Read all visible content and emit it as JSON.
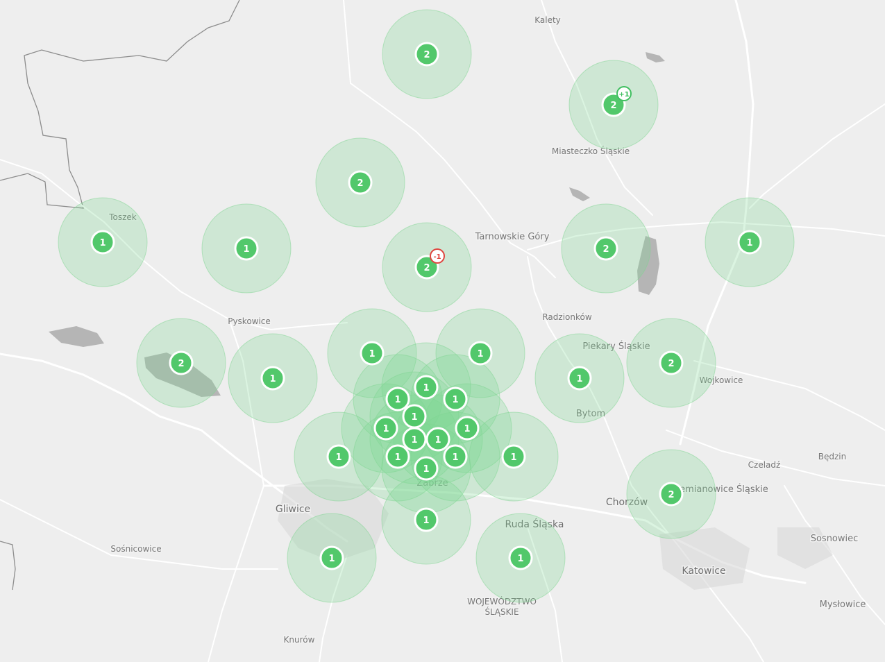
{
  "map": {
    "places": [
      {
        "name": "Kalety",
        "size": "small",
        "id": "kalety"
      },
      {
        "name": "Miasteczko Śląskie",
        "size": "small",
        "id": "miasteczko"
      },
      {
        "name": "Toszek",
        "size": "small",
        "id": "toszek"
      },
      {
        "name": "Tarnowskie Góry",
        "size": "med",
        "id": "tarnowskie-gory"
      },
      {
        "name": "Radzionków",
        "size": "small",
        "id": "radzionkow"
      },
      {
        "name": "Pyskowice",
        "size": "small",
        "id": "pyskowice"
      },
      {
        "name": "Piekary Śląskie",
        "size": "med",
        "id": "piekary"
      },
      {
        "name": "Wojkowice",
        "size": "small",
        "id": "wojkowice"
      },
      {
        "name": "Bytom",
        "size": "med",
        "id": "bytom"
      },
      {
        "name": "Czeladź",
        "size": "small",
        "id": "czeladz"
      },
      {
        "name": "Będzin",
        "size": "small",
        "id": "bedzin"
      },
      {
        "name": "Siemianowice Śląskie",
        "size": "med",
        "id": "siemianowice"
      },
      {
        "name": "Zabrze",
        "size": "med",
        "id": "zabrze"
      },
      {
        "name": "Gliwice",
        "size": "large",
        "id": "gliwice"
      },
      {
        "name": "Chorzów",
        "size": "large",
        "id": "chorzow"
      },
      {
        "name": "Ruda Śląska",
        "size": "large",
        "id": "ruda"
      },
      {
        "name": "Sośnicowice",
        "size": "small",
        "id": "sosnicowice"
      },
      {
        "name": "Sosnowiec",
        "size": "med",
        "id": "sosnowiec"
      },
      {
        "name": "Katowice",
        "size": "large",
        "id": "katowice"
      },
      {
        "name": "Mysłowice",
        "size": "med",
        "id": "myslowice"
      },
      {
        "name": "Knurów",
        "size": "small",
        "id": "knurow"
      },
      {
        "name": "WOJEWÓDZTWO",
        "size": "small",
        "id": "wojewodztwo-1"
      },
      {
        "name": "ŚLĄSKIE",
        "size": "small",
        "id": "wojewodztwo-2"
      }
    ],
    "clusters": [
      {
        "count": "2",
        "id": "c01"
      },
      {
        "count": "2",
        "id": "c02",
        "badge": "+1",
        "badge_color": "#3fbf5f"
      },
      {
        "count": "2",
        "id": "c03"
      },
      {
        "count": "1",
        "id": "c04"
      },
      {
        "count": "1",
        "id": "c05"
      },
      {
        "count": "2",
        "id": "c06",
        "badge": "-1",
        "badge_color": "#e0443e"
      },
      {
        "count": "2",
        "id": "c07"
      },
      {
        "count": "1",
        "id": "c08"
      },
      {
        "count": "2",
        "id": "c09"
      },
      {
        "count": "1",
        "id": "c10"
      },
      {
        "count": "1",
        "id": "c11"
      },
      {
        "count": "1",
        "id": "c12"
      },
      {
        "count": "1",
        "id": "c13"
      },
      {
        "count": "2",
        "id": "c14"
      },
      {
        "count": "1",
        "id": "c15"
      },
      {
        "count": "1",
        "id": "c16"
      },
      {
        "count": "1",
        "id": "c17"
      },
      {
        "count": "1",
        "id": "c18"
      },
      {
        "count": "1",
        "id": "c19"
      },
      {
        "count": "1",
        "id": "c20"
      },
      {
        "count": "1",
        "id": "c21"
      },
      {
        "count": "1",
        "id": "c22"
      },
      {
        "count": "1",
        "id": "c23"
      },
      {
        "count": "1",
        "id": "c24"
      },
      {
        "count": "1",
        "id": "c25"
      },
      {
        "count": "1",
        "id": "c26"
      },
      {
        "count": "1",
        "id": "c27"
      },
      {
        "count": "2",
        "id": "c28"
      },
      {
        "count": "1",
        "id": "c29"
      },
      {
        "count": "1",
        "id": "c30"
      },
      {
        "count": "1",
        "id": "c31"
      }
    ],
    "colors": {
      "background": "#eeeeee",
      "road": "#ffffff",
      "water": "#a9a9a9",
      "boundary": "#8a8a8a",
      "cluster_halo": "#7fd692",
      "cluster_fill": "#52c86b"
    }
  }
}
